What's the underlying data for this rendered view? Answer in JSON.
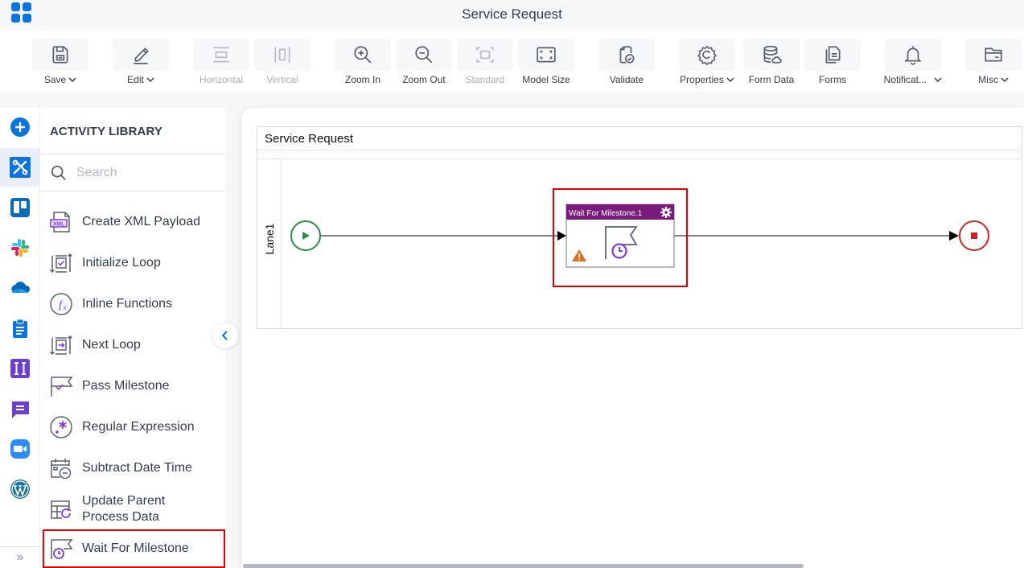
{
  "app": {
    "title": "Service Request",
    "apps_icon": "app-grid-icon"
  },
  "toolbar": {
    "buttons": [
      {
        "id": "save",
        "label": "Save",
        "icon": "save-icon",
        "dropdown": true,
        "disabled": false
      },
      {
        "id": "edit",
        "label": "Edit",
        "icon": "pencil-icon",
        "dropdown": true,
        "disabled": false
      },
      {
        "id": "horizontal",
        "label": "Horizontal",
        "icon": "align-horizontal-icon",
        "dropdown": false,
        "disabled": true
      },
      {
        "id": "vertical",
        "label": "Vertical",
        "icon": "align-vertical-icon",
        "dropdown": false,
        "disabled": true
      },
      {
        "id": "zoom-in",
        "label": "Zoom In",
        "icon": "zoom-in-icon",
        "dropdown": false,
        "disabled": false
      },
      {
        "id": "zoom-out",
        "label": "Zoom Out",
        "icon": "zoom-out-icon",
        "dropdown": false,
        "disabled": false
      },
      {
        "id": "standard",
        "label": "Standard",
        "icon": "standard-size-icon",
        "dropdown": false,
        "disabled": true
      },
      {
        "id": "model-size",
        "label": "Model Size",
        "icon": "fit-screen-icon",
        "dropdown": false,
        "disabled": false
      },
      {
        "id": "validate",
        "label": "Validate",
        "icon": "validate-icon",
        "dropdown": false,
        "disabled": false
      },
      {
        "id": "properties",
        "label": "Properties",
        "icon": "gear-icon",
        "dropdown": true,
        "disabled": false
      },
      {
        "id": "form-data",
        "label": "Form Data",
        "icon": "database-icon",
        "dropdown": false,
        "disabled": false
      },
      {
        "id": "forms",
        "label": "Forms",
        "icon": "forms-icon",
        "dropdown": false,
        "disabled": false
      },
      {
        "id": "notifications",
        "label": "Notificat...",
        "icon": "bell-icon",
        "dropdown": true,
        "disabled": false
      },
      {
        "id": "misc",
        "label": "Misc",
        "icon": "folder-icon",
        "dropdown": true,
        "disabled": false
      }
    ]
  },
  "rail": {
    "items": [
      {
        "name": "add",
        "icon": "plus-circle-icon",
        "active": false
      },
      {
        "name": "utilities",
        "icon": "wrench-icon",
        "active": true
      },
      {
        "name": "trello",
        "icon": "trello-icon",
        "active": false
      },
      {
        "name": "slack",
        "icon": "slack-icon",
        "active": false
      },
      {
        "name": "onedrive",
        "icon": "onedrive-icon",
        "active": false
      },
      {
        "name": "clipboard",
        "icon": "clipboard-icon",
        "active": false
      },
      {
        "name": "integration",
        "icon": "ii-icon",
        "active": false
      },
      {
        "name": "chat",
        "icon": "chat-icon",
        "active": false
      },
      {
        "name": "zoom",
        "icon": "video-icon",
        "active": false
      },
      {
        "name": "wordpress",
        "icon": "wordpress-icon",
        "active": false
      }
    ],
    "expand_label": "»"
  },
  "library": {
    "title": "ACTIVITY LIBRARY",
    "search_placeholder": "Search",
    "search_value": "",
    "items": [
      {
        "label": "Create XML Payload",
        "icon": "xml-file-icon"
      },
      {
        "label": "Initialize Loop",
        "icon": "initialize-loop-icon"
      },
      {
        "label": "Inline Functions",
        "icon": "function-icon"
      },
      {
        "label": "Next Loop",
        "icon": "next-loop-icon"
      },
      {
        "label": "Pass Milestone",
        "icon": "pass-milestone-icon"
      },
      {
        "label": "Regular Expression",
        "icon": "regex-icon"
      },
      {
        "label": "Subtract Date Time",
        "icon": "subtract-date-icon"
      },
      {
        "label": "Update Parent Process Data",
        "label_line1": "Update Parent",
        "label_line2": "Process Data",
        "icon": "update-parent-icon"
      },
      {
        "label": "Wait For Milestone",
        "icon": "wait-milestone-icon",
        "selected": true
      }
    ]
  },
  "canvas": {
    "pool_title": "Service Request",
    "lane_label": "Lane1",
    "start_event": {
      "type": "start",
      "color": "#2e8b4e"
    },
    "activity": {
      "title": "Wait For Milestone.1",
      "header_color": "#7b1a7d",
      "warning": true,
      "selected": true
    },
    "end_event": {
      "type": "end",
      "color": "#c62828"
    }
  },
  "colors": {
    "accent": "#0b74de",
    "selection": "#e00000",
    "icon_purple": "#7c3aed",
    "icon_gray": "#5a6070"
  }
}
